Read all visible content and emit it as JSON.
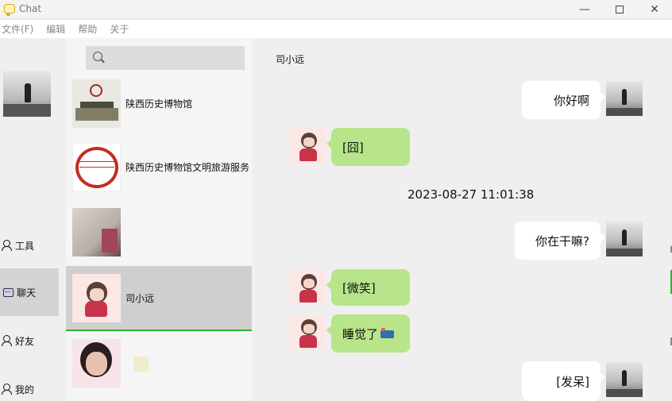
{
  "window": {
    "title": "Chat",
    "controls": {
      "minimize": "—",
      "close": "✕"
    }
  },
  "menu": [
    "文件(F)",
    "编辑",
    "帮助",
    "关于"
  ],
  "nav": {
    "items": [
      {
        "label": "工具",
        "icon": "person-icon"
      },
      {
        "label": "聊天",
        "icon": "chat-icon",
        "active": true
      },
      {
        "label": "好友",
        "icon": "person-icon"
      },
      {
        "label": "我的",
        "icon": "person-icon"
      }
    ]
  },
  "search": {
    "placeholder": ""
  },
  "contacts": [
    {
      "name": "陕西历史博物馆"
    },
    {
      "name": "陕西历史博物馆文明旅游服务"
    },
    {
      "name": ""
    },
    {
      "name": "司小远",
      "selected": true
    },
    {
      "name": ""
    }
  ],
  "chat": {
    "title": "司小远",
    "messages": [
      {
        "side": "right",
        "text": "你好啊"
      },
      {
        "side": "left",
        "text": "[囧]"
      },
      {
        "side": "center",
        "text": "2023-08-27 11:01:38"
      },
      {
        "side": "right",
        "text": "你在干嘛?"
      },
      {
        "side": "left",
        "text": "[微笑]"
      },
      {
        "side": "left",
        "text": "睡觉了"
      },
      {
        "side": "right",
        "text": "[发呆]"
      }
    ]
  },
  "colors": {
    "selected_underline": "#2db52d",
    "peer_bubble": "#b8e58a",
    "self_bubble": "#ffffff"
  }
}
